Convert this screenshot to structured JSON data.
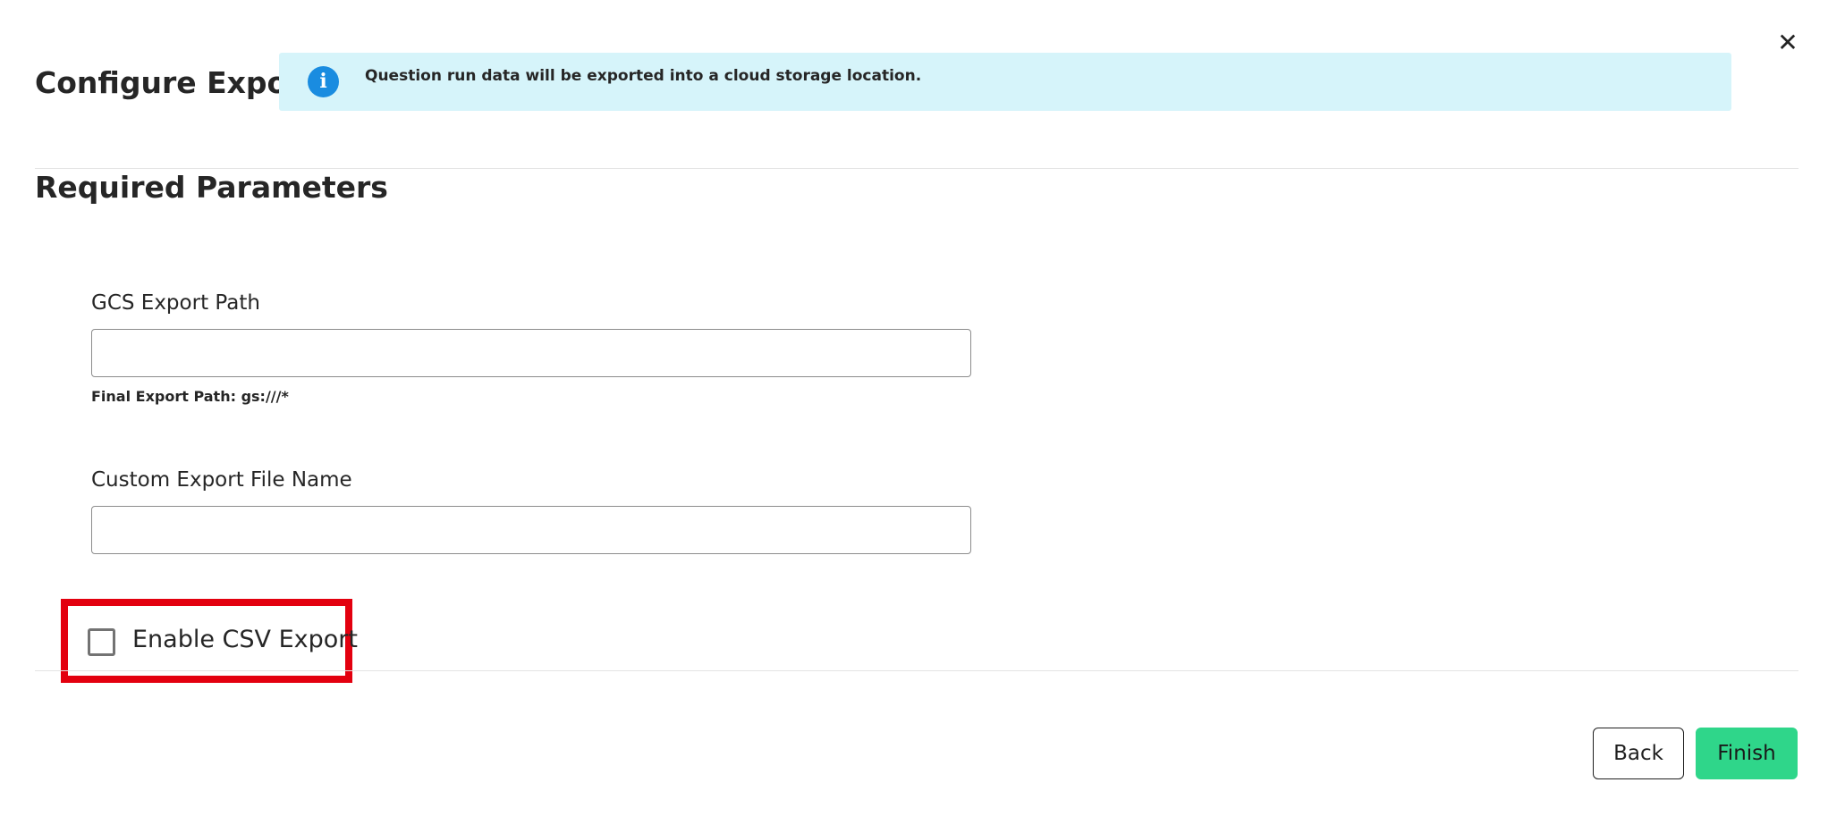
{
  "header": {
    "title": "Configure Export",
    "info_icon_glyph": "i",
    "info_message": "Question run data will be exported into a cloud storage location.",
    "close_glyph": "✕",
    "banner_color": "#d6f4fa",
    "info_icon_color": "#1a8ce0"
  },
  "section": {
    "title": "Required Parameters"
  },
  "fields": {
    "gcs_export_path": {
      "label": "GCS Export Path",
      "value": "",
      "helper": "Final Export Path: gs:///*"
    },
    "custom_file_name": {
      "label": "Custom Export File Name",
      "value": ""
    }
  },
  "csv_export": {
    "label": "Enable CSV Export",
    "checked": false,
    "highlight_color": "#e3000f"
  },
  "footer": {
    "back_label": "Back",
    "finish_label": "Finish",
    "finish_color": "#2fd68a"
  }
}
